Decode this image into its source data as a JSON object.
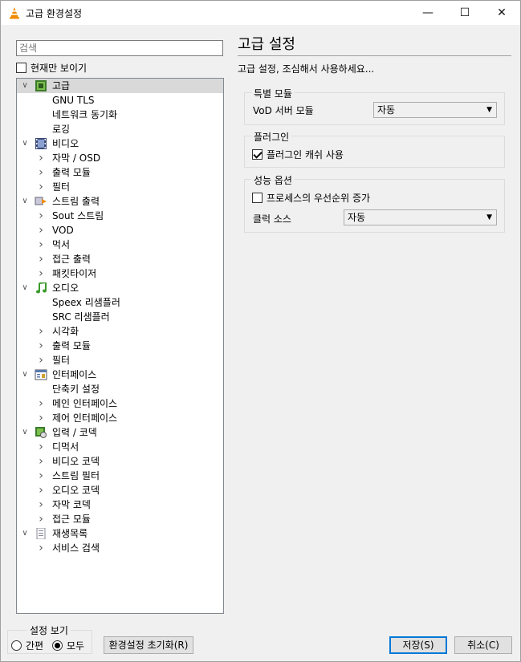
{
  "window": {
    "title": "고급 환경설정",
    "minimize": "—",
    "maximize": "☐",
    "close": "✕"
  },
  "sidebar": {
    "search_placeholder": "검색",
    "show_current_only": "현재만 보이기",
    "tree": [
      {
        "label": "고급",
        "level": 0,
        "expand": "expanded",
        "icon": "chip-icon",
        "selected": true
      },
      {
        "label": "GNU TLS",
        "level": 1,
        "expand": "none"
      },
      {
        "label": "네트워크 동기화",
        "level": 1,
        "expand": "none"
      },
      {
        "label": "로깅",
        "level": 1,
        "expand": "none"
      },
      {
        "label": "비디오",
        "level": 0,
        "expand": "expanded",
        "icon": "film-icon"
      },
      {
        "label": "자막 / OSD",
        "level": 1,
        "expand": "collapsed"
      },
      {
        "label": "출력 모듈",
        "level": 1,
        "expand": "collapsed"
      },
      {
        "label": "필터",
        "level": 1,
        "expand": "collapsed"
      },
      {
        "label": "스트림 출력",
        "level": 0,
        "expand": "expanded",
        "icon": "stream-output-icon"
      },
      {
        "label": "Sout 스트림",
        "level": 1,
        "expand": "collapsed"
      },
      {
        "label": "VOD",
        "level": 1,
        "expand": "collapsed"
      },
      {
        "label": "먹서",
        "level": 1,
        "expand": "collapsed"
      },
      {
        "label": "접근 출력",
        "level": 1,
        "expand": "collapsed"
      },
      {
        "label": "패킷타이저",
        "level": 1,
        "expand": "collapsed"
      },
      {
        "label": "오디오",
        "level": 0,
        "expand": "expanded",
        "icon": "music-note-icon"
      },
      {
        "label": "Speex 리샘플러",
        "level": 1,
        "expand": "none"
      },
      {
        "label": "SRC 리샘플러",
        "level": 1,
        "expand": "none"
      },
      {
        "label": "시각화",
        "level": 1,
        "expand": "collapsed"
      },
      {
        "label": "출력 모듈",
        "level": 1,
        "expand": "collapsed"
      },
      {
        "label": "필터",
        "level": 1,
        "expand": "collapsed"
      },
      {
        "label": "인터페이스",
        "level": 0,
        "expand": "expanded",
        "icon": "interface-icon"
      },
      {
        "label": "단축키 설정",
        "level": 1,
        "expand": "none"
      },
      {
        "label": "메인 인터페이스",
        "level": 1,
        "expand": "collapsed"
      },
      {
        "label": "제어 인터페이스",
        "level": 1,
        "expand": "collapsed"
      },
      {
        "label": "입력 / 코덱",
        "level": 0,
        "expand": "expanded",
        "icon": "codec-icon"
      },
      {
        "label": "디먹서",
        "level": 1,
        "expand": "collapsed"
      },
      {
        "label": "비디오 코덱",
        "level": 1,
        "expand": "collapsed"
      },
      {
        "label": "스트림 필터",
        "level": 1,
        "expand": "collapsed"
      },
      {
        "label": "오디오 코덱",
        "level": 1,
        "expand": "collapsed"
      },
      {
        "label": "자막 코덱",
        "level": 1,
        "expand": "collapsed"
      },
      {
        "label": "접근 모듈",
        "level": 1,
        "expand": "collapsed"
      },
      {
        "label": "재생목록",
        "level": 0,
        "expand": "expanded",
        "icon": "playlist-icon"
      },
      {
        "label": "서비스 검색",
        "level": 1,
        "expand": "collapsed"
      }
    ]
  },
  "pane": {
    "title": "고급 설정",
    "description": "고급 설정, 조심해서 사용하세요...",
    "special_modules": {
      "label": "특별 모듈",
      "vod_label": "VoD 서버 모듈",
      "vod_value": "자동"
    },
    "plugins": {
      "label": "플러그인",
      "cache_label": "플러그인 캐쉬 사용",
      "cache_checked": true
    },
    "performance": {
      "label": "성능 옵션",
      "priority_label": "프로세스의 우선순위 증가",
      "priority_checked": false,
      "clock_label": "클럭 소스",
      "clock_value": "자동"
    }
  },
  "footer": {
    "view_group": "설정 보기",
    "simple": "간편",
    "all": "모두",
    "reset": "환경설정 초기화(R)",
    "save": "저장(S)",
    "cancel": "취소(C)"
  }
}
